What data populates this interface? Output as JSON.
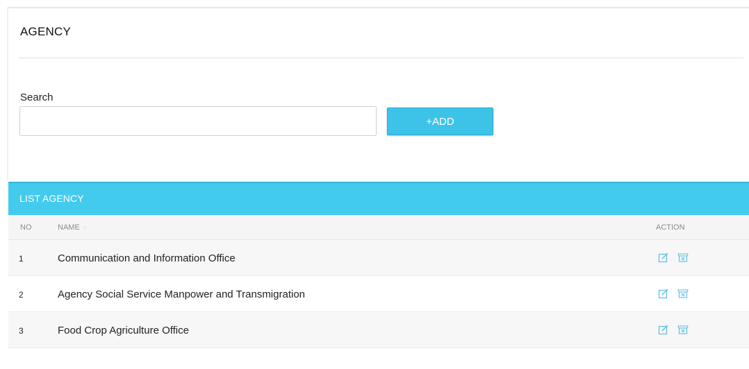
{
  "page": {
    "title": "AGENCY"
  },
  "search": {
    "label": "Search",
    "value": "",
    "placeholder": ""
  },
  "toolbar": {
    "add_label": "+ADD"
  },
  "panel": {
    "title": "LIST AGENCY"
  },
  "table": {
    "headers": {
      "no": "NO",
      "name": "NAME",
      "action": "ACTION"
    },
    "rows": [
      {
        "no": "1",
        "name": "Communication and Information Office"
      },
      {
        "no": "2",
        "name": "Agency Social Service Manpower and Transmigration"
      },
      {
        "no": "3",
        "name": "Food Crop Agriculture Office"
      }
    ]
  },
  "colors": {
    "accent": "#42cbed",
    "button": "#3ec3e8",
    "icon": "#5bbfe0"
  },
  "icons": {
    "edit": "edit-icon",
    "delete": "delete-icon"
  }
}
